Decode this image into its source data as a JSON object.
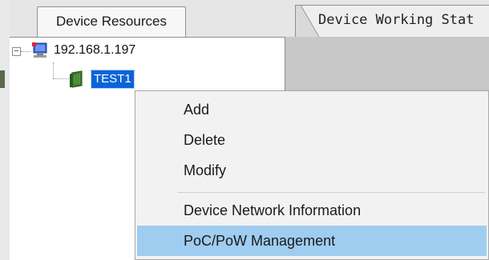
{
  "tabs": {
    "device_resources": "Device Resources",
    "device_working_status": "Device Working Stat"
  },
  "tree": {
    "root_label": "192.168.1.197",
    "root_expander": "−",
    "child_label": "TEST1"
  },
  "context_menu": {
    "items": [
      {
        "label": "Add"
      },
      {
        "label": "Delete"
      },
      {
        "label": "Modify"
      },
      {
        "label": "Device Network Information"
      },
      {
        "label": "PoC/PoW Management",
        "selected": true
      }
    ]
  },
  "colors": {
    "selection_blue": "#0a64d8",
    "menu_highlight": "#9fcdf0"
  }
}
